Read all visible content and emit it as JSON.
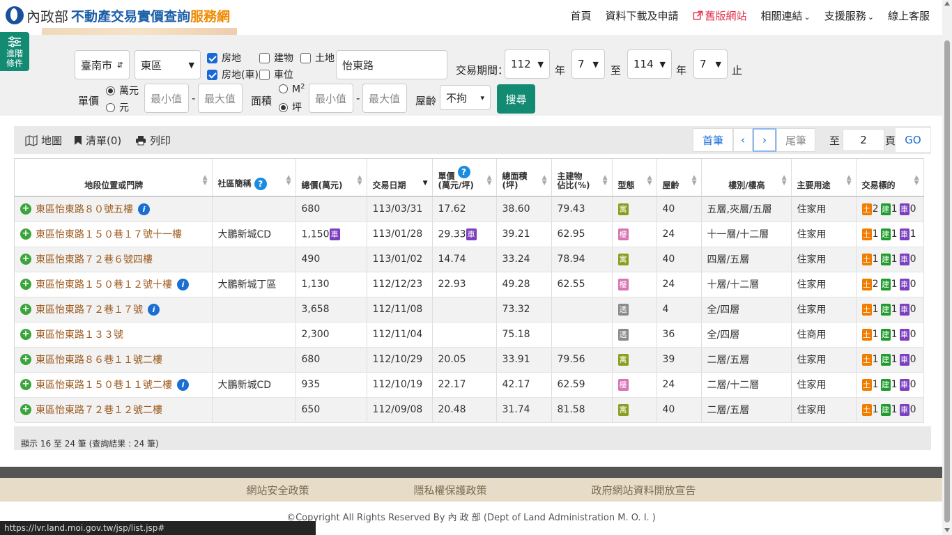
{
  "header": {
    "logo_calligraphy": "內政部",
    "logo_main": "不動產交易實價查詢",
    "logo_accent": "服務網",
    "nav": [
      {
        "label": "首頁"
      },
      {
        "label": "資料下載及申請"
      },
      {
        "label": "舊版網站"
      },
      {
        "label": "相關連結"
      },
      {
        "label": "支援服務"
      },
      {
        "label": "線上客服"
      }
    ]
  },
  "side_tab": {
    "line1": "進階",
    "line2": "條件"
  },
  "filters": {
    "city": "臺南市",
    "district": "東區",
    "checkboxes": [
      {
        "label": "房地",
        "checked": true
      },
      {
        "label": "建物",
        "checked": false
      },
      {
        "label": "土地",
        "checked": false
      },
      {
        "label": "房地(車)",
        "checked": true
      },
      {
        "label": "車位",
        "checked": false
      }
    ],
    "road": "怡東路",
    "period_label": "交易期間：",
    "start_year": "112",
    "start_month": "7",
    "end_year": "114",
    "end_month": "7",
    "year_unit": "年",
    "to_label": "至",
    "end_label": "止",
    "unit_price_label": "單價",
    "unit_price_options": [
      "萬元",
      "元"
    ],
    "min_placeholder": "最小值",
    "max_placeholder": "最大值",
    "dash": "-",
    "area_label": "面積",
    "area_options": [
      "M",
      "坪"
    ],
    "area_sup": "2",
    "age_label": "屋齡",
    "age_value": "不拘",
    "search_label": "搜尋"
  },
  "toolbar": {
    "map": "地圖",
    "list": "清單(0)",
    "print": "列印",
    "first": "首筆",
    "prev": "‹",
    "next": "›",
    "last": "尾筆",
    "goto_label": "至",
    "page_value": "2",
    "page_unit": "頁",
    "go": "GO"
  },
  "table": {
    "headers": [
      "地段位置或門牌",
      "社區簡稱",
      "總價(萬元)",
      "交易日期",
      "單價\n(萬元/坪)",
      "總面積\n(坪)",
      "主建物\n佔比(%)",
      "型態",
      "屋齡",
      "樓別/樓高",
      "主要用途",
      "交易標的"
    ],
    "rows": [
      {
        "addr": "東區怡東路８０號五樓",
        "info": true,
        "community": "",
        "total": "680",
        "car": false,
        "date": "113/03/31",
        "unit": "17.62",
        "unit_car": false,
        "area": "38.60",
        "ratio": "79.43",
        "type": "寓",
        "age": "40",
        "floor": "五層,夾層/五層",
        "use": "住家用",
        "land": "2",
        "bldg": "1",
        "park": "0"
      },
      {
        "addr": "東區怡東路１５０巷１７號十一樓",
        "info": false,
        "community": "大鵬新城CD",
        "total": "1,150",
        "car": true,
        "date": "113/01/28",
        "unit": "29.33",
        "unit_car": true,
        "area": "39.21",
        "ratio": "62.95",
        "type": "樓",
        "age": "24",
        "floor": "十一層/十二層",
        "use": "住家用",
        "land": "1",
        "bldg": "1",
        "park": "1"
      },
      {
        "addr": "東區怡東路７２巷６號四樓",
        "info": false,
        "community": "",
        "total": "490",
        "car": false,
        "date": "113/01/02",
        "unit": "14.74",
        "unit_car": false,
        "area": "33.24",
        "ratio": "78.94",
        "type": "寓",
        "age": "40",
        "floor": "四層/五層",
        "use": "住家用",
        "land": "1",
        "bldg": "1",
        "park": "0"
      },
      {
        "addr": "東區怡東路１５０巷１２號十樓",
        "info": true,
        "community": "大鵬新城丁區",
        "total": "1,130",
        "car": false,
        "date": "112/12/23",
        "unit": "22.93",
        "unit_car": false,
        "area": "49.28",
        "ratio": "62.55",
        "type": "樓",
        "age": "24",
        "floor": "十層/十二層",
        "use": "住家用",
        "land": "2",
        "bldg": "1",
        "park": "0"
      },
      {
        "addr": "東區怡東路７２巷１７號",
        "info": true,
        "community": "",
        "total": "3,658",
        "car": false,
        "date": "112/11/08",
        "unit": "",
        "unit_car": false,
        "area": "73.32",
        "ratio": "",
        "type": "透",
        "age": "4",
        "floor": "全/四層",
        "use": "住家用",
        "land": "1",
        "bldg": "1",
        "park": "0"
      },
      {
        "addr": "東區怡東路１３３號",
        "info": false,
        "community": "",
        "total": "2,300",
        "car": false,
        "date": "112/11/04",
        "unit": "",
        "unit_car": false,
        "area": "75.18",
        "ratio": "",
        "type": "透",
        "age": "36",
        "floor": "全/四層",
        "use": "住商用",
        "land": "1",
        "bldg": "1",
        "park": "0"
      },
      {
        "addr": "東區怡東路８６巷１１號二樓",
        "info": false,
        "community": "",
        "total": "680",
        "car": false,
        "date": "112/10/29",
        "unit": "20.05",
        "unit_car": false,
        "area": "33.91",
        "ratio": "79.56",
        "type": "寓",
        "age": "39",
        "floor": "二層/五層",
        "use": "住家用",
        "land": "1",
        "bldg": "1",
        "park": "0"
      },
      {
        "addr": "東區怡東路１５０巷１１號二樓",
        "info": true,
        "community": "大鵬新城CD",
        "total": "935",
        "car": false,
        "date": "112/10/19",
        "unit": "22.17",
        "unit_car": false,
        "area": "42.17",
        "ratio": "62.59",
        "type": "樓",
        "age": "24",
        "floor": "二層/十二層",
        "use": "住家用",
        "land": "1",
        "bldg": "1",
        "park": "0"
      },
      {
        "addr": "東區怡東路７２巷１２號二樓",
        "info": false,
        "community": "",
        "total": "650",
        "car": false,
        "date": "112/09/08",
        "unit": "20.48",
        "unit_car": false,
        "area": "31.74",
        "ratio": "81.58",
        "type": "寓",
        "age": "40",
        "floor": "二層/五層",
        "use": "住家用",
        "land": "1",
        "bldg": "1",
        "park": "0"
      }
    ],
    "car_tag": "車",
    "land_tag": "土",
    "bldg_tag": "建",
    "park_tag": "車",
    "info_glyph": "i",
    "plus_glyph": "+",
    "help_glyph": "?"
  },
  "summary": "顯示 16 至 24 筆 (查詢結果 : 24 筆)",
  "footer": {
    "links": [
      "網站安全政策",
      "隱私權保護政策",
      "政府網站資料開放宣告"
    ],
    "copyright": "©Copyright All Rights Reserved By 內 政 部 (Dept of Land Administration M. O. I. )"
  },
  "status_url": "https://lvr.land.moi.gov.tw/jsp/list.jsp#"
}
